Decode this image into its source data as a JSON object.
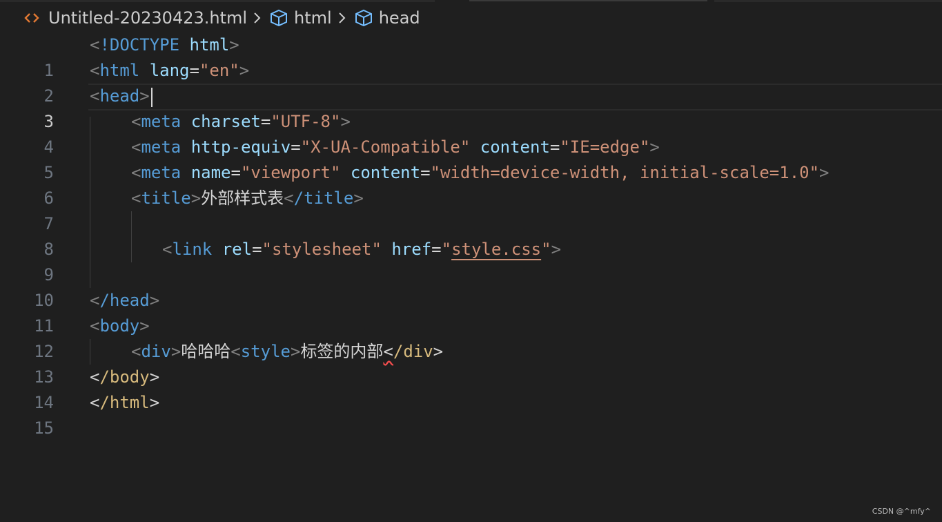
{
  "breadcrumb": {
    "file": "Untitled-20230423.html",
    "items": [
      "html",
      "head"
    ],
    "file_icon": "html-file-icon",
    "symbol_icon": "cube-icon"
  },
  "editor": {
    "active_line": 3,
    "lines": [
      {
        "n": "1"
      },
      {
        "n": "2"
      },
      {
        "n": "3"
      },
      {
        "n": "4"
      },
      {
        "n": "5"
      },
      {
        "n": "6"
      },
      {
        "n": "7"
      },
      {
        "n": "8"
      },
      {
        "n": "9"
      },
      {
        "n": "10"
      },
      {
        "n": "11"
      },
      {
        "n": "12"
      },
      {
        "n": "13"
      },
      {
        "n": "14"
      },
      {
        "n": "15"
      }
    ],
    "tokens": {
      "l1_doctype": "!DOCTYPE",
      "l1_html": "html",
      "l2_tag": "html",
      "l2_attr": "lang",
      "l2_val": "\"en\"",
      "l3_tag": "head",
      "l4_tag": "meta",
      "l4_attr": "charset",
      "l4_val": "\"UTF-8\"",
      "l5_tag": "meta",
      "l5_attr1": "http-equiv",
      "l5_val1": "\"X-UA-Compatible\"",
      "l5_attr2": "content",
      "l5_val2": "\"IE=edge\"",
      "l6_tag": "meta",
      "l6_attr1": "name",
      "l6_val1": "\"viewport\"",
      "l6_attr2": "content",
      "l6_val2": "\"width=device-width, initial-scale=1.0\"",
      "l7_tag": "title",
      "l7_text": "外部样式表",
      "l7_close": "/title",
      "l9_tag": "link",
      "l9_attr1": "rel",
      "l9_val1": "\"stylesheet\"",
      "l9_attr2": "href",
      "l9_val2_q1": "\"",
      "l9_val2": "style.css",
      "l9_val2_q2": "\"",
      "l11_tag": "/head",
      "l12_tag": "body",
      "l13_tag": "div",
      "l13_text1": "哈哈哈",
      "l13_style": "style",
      "l13_text2": "标签的内部",
      "l13_close": "/div",
      "l14_tag": "/body",
      "l15_tag": "/html"
    }
  },
  "colors": {
    "background": "#1f1f1f",
    "tag": "#569cd6",
    "attribute": "#9cdcfe",
    "string": "#ce9178",
    "bracket": "#808080",
    "error": "#f14c4c"
  },
  "watermark": "CSDN @^mfy^"
}
